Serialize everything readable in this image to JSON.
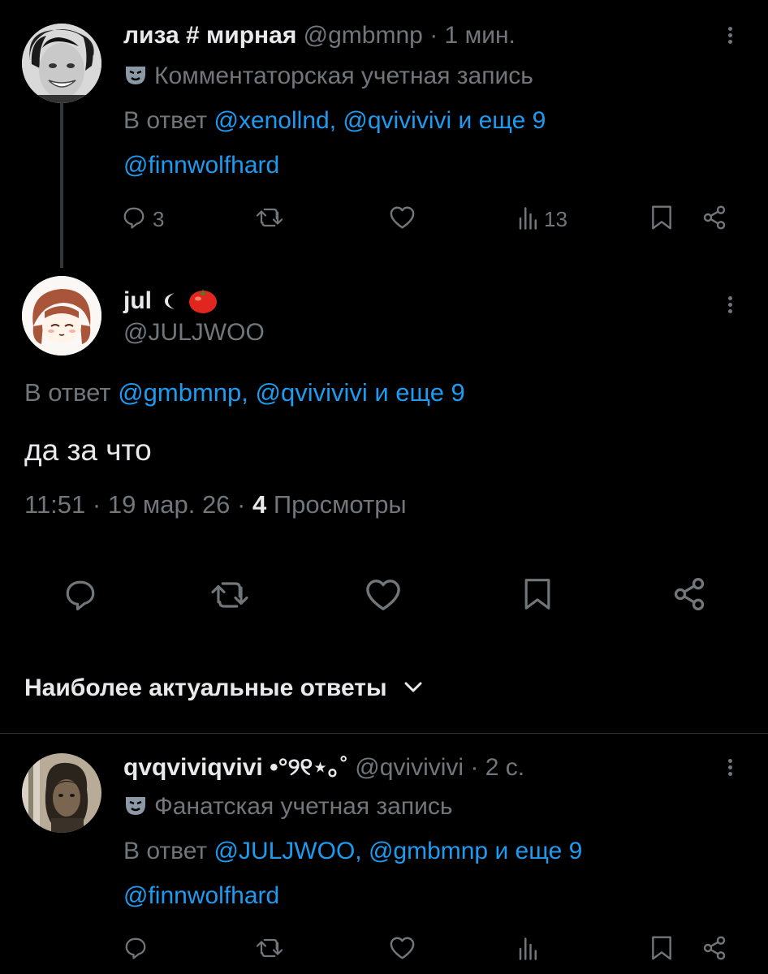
{
  "tweets": [
    {
      "name": "лиза # мирная",
      "handle": "@gmbmnp",
      "sep": "·",
      "time": "1 мин.",
      "account_label": "Комментаторская учетная запись",
      "reply_prefix": "В ответ",
      "reply_to": "@xenollnd, @qvivivivi и еще 9",
      "reply_to_line2": "@finnwolfhard",
      "reply_count": "3",
      "views_count": "13"
    },
    {
      "name": "jul",
      "handle": "@JULJWOO",
      "reply_prefix": "В ответ",
      "reply_to": "@gmbmnp, @qvivivivi и еще 9",
      "text": "да за что",
      "meta_time": "11:51 · 19 мар. 26 ·",
      "views_count": "4",
      "views_label": "Просмотры"
    },
    {
      "name": "qvqviviqvivi •°୨୧⋆｡˚",
      "handle": "@qvivivivi",
      "sep": "·",
      "time": "2 с.",
      "account_label": "Фанатская учетная запись",
      "reply_prefix": "В ответ",
      "reply_to": "@JULJWOO, @gmbmnp и еще 9",
      "reply_to_line2": "@finnwolfhard"
    }
  ],
  "replies_sort": {
    "label": "Наиболее актуальные ответы"
  },
  "icons": [
    "more-icon",
    "mask-icon",
    "reply-icon",
    "retweet-icon",
    "like-icon",
    "views-icon",
    "bookmark-icon",
    "share-icon",
    "chevron-down-icon",
    "moon-icon",
    "tomato-icon"
  ],
  "colors": {
    "background": "#000000",
    "text": "#e7e9ea",
    "secondary": "#71767b",
    "link": "#1d9bf0"
  }
}
